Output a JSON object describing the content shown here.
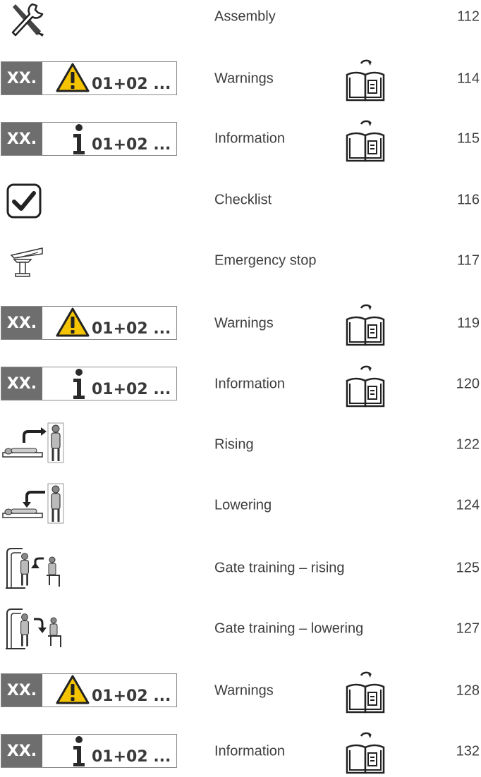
{
  "rows": [
    {
      "label": "Assembly",
      "page": "112"
    },
    {
      "label": "Warnings",
      "page": "114",
      "box_tag": "XX.",
      "box_code": "01+02 ..."
    },
    {
      "label": "Information",
      "page": "115",
      "box_tag": "XX.",
      "box_code": "01+02 ..."
    },
    {
      "label": "Checklist",
      "page": "116"
    },
    {
      "label": "Emergency stop",
      "page": "117"
    },
    {
      "label": "Warnings",
      "page": "119",
      "box_tag": "XX.",
      "box_code": "01+02 ..."
    },
    {
      "label": "Information",
      "page": "120",
      "box_tag": "XX.",
      "box_code": "01+02 ..."
    },
    {
      "label": "Rising",
      "page": "122"
    },
    {
      "label": "Lowering",
      "page": "124"
    },
    {
      "label": "Gate training – rising",
      "page": "125"
    },
    {
      "label": "Gate training – lowering",
      "page": "127"
    },
    {
      "label": "Warnings",
      "page": "128",
      "box_tag": "XX.",
      "box_code": "01+02 ..."
    },
    {
      "label": "Information",
      "page": "132",
      "box_tag": "XX.",
      "box_code": "01+02 ..."
    }
  ],
  "icons": {
    "assembly": "wrench-screwdriver-icon",
    "warning": "warning-triangle-icon",
    "info": "info-i-icon",
    "checklist": "checkbox-checked-icon",
    "emergency": "emergency-stop-icon",
    "rising": "patient-rising-icon",
    "lowering": "patient-lowering-icon",
    "gate_rising": "gate-training-rising-icon",
    "gate_lowering": "gate-training-lowering-icon",
    "manual": "read-manual-icon"
  },
  "colors": {
    "tag_bg": "#6e6e6e",
    "warning_yellow": "#f5c400",
    "text": "#3d3d3d"
  }
}
